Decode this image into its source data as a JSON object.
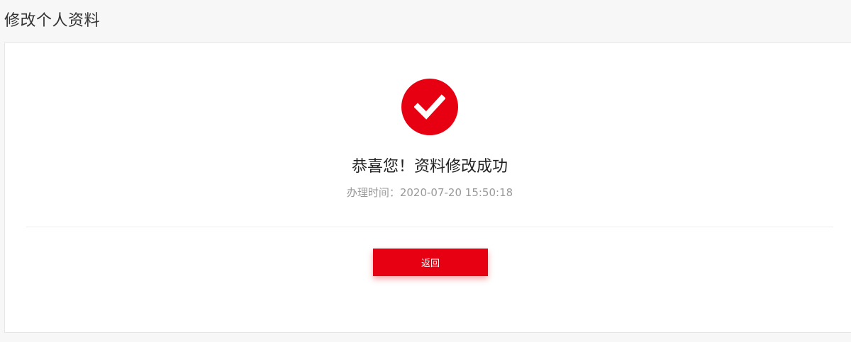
{
  "header": {
    "title": "修改个人资料"
  },
  "result": {
    "icon": "check-circle-icon",
    "title": "恭喜您！资料修改成功",
    "time_label": "办理时间：",
    "time_value": "2020-07-20 15:50:18"
  },
  "actions": {
    "back_label": "返回"
  },
  "colors": {
    "accent": "#e60012",
    "page_background": "#f7f7f7",
    "card_background": "#ffffff",
    "muted_text": "#999999"
  }
}
